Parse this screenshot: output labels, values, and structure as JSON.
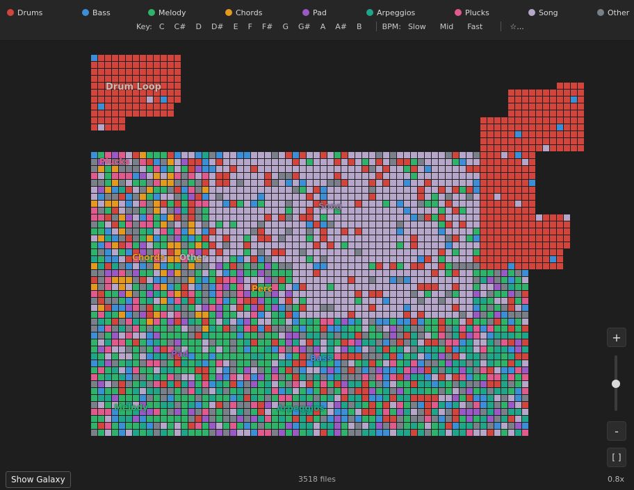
{
  "legend": [
    {
      "label": "Drums",
      "color": "#d2453d"
    },
    {
      "label": "Bass",
      "color": "#3a8fd6"
    },
    {
      "label": "Melody",
      "color": "#2fb36b"
    },
    {
      "label": "Chords",
      "color": "#e39a1f"
    },
    {
      "label": "Pad",
      "color": "#9b59c6"
    },
    {
      "label": "Arpeggios",
      "color": "#1fa589"
    },
    {
      "label": "Plucks",
      "color": "#e05a8e"
    },
    {
      "label": "Song",
      "color": "#b6a6c9"
    },
    {
      "label": "Other",
      "color": "#798089"
    }
  ],
  "filters": {
    "key_label": "Key:",
    "keys": [
      "C",
      "C#",
      "D",
      "D#",
      "E",
      "F",
      "F#",
      "G",
      "G#",
      "A",
      "A#",
      "B"
    ],
    "bpm_label": "BPM:",
    "bpm_options": [
      "Slow",
      "Mid",
      "Fast"
    ],
    "favorites_label": "☆..."
  },
  "clusters": [
    {
      "label": "Drum Loop",
      "color": "#c8b8b0"
    },
    {
      "label": "Plucks",
      "color": "#e05a8e"
    },
    {
      "label": "Song",
      "color": "#8c7a9c"
    },
    {
      "label": "Chords",
      "color": "#e39a1f"
    },
    {
      "label": "Other",
      "color": "#b0b6be"
    },
    {
      "label": "Perc",
      "color": "#e3a01f"
    },
    {
      "label": "Pad",
      "color": "#9b59c6"
    },
    {
      "label": "Bass",
      "color": "#3a8fd6"
    },
    {
      "label": "Melody",
      "color": "#2fb36b"
    },
    {
      "label": "Arpeggios",
      "color": "#1fa589"
    }
  ],
  "zoom": {
    "in_label": "+",
    "out_label": "-",
    "fit_label": "[ ]",
    "level": "0.8x",
    "slider_fraction": 0.5
  },
  "footer": {
    "galaxy_button": "Show Galaxy",
    "file_count": "3518 files"
  }
}
